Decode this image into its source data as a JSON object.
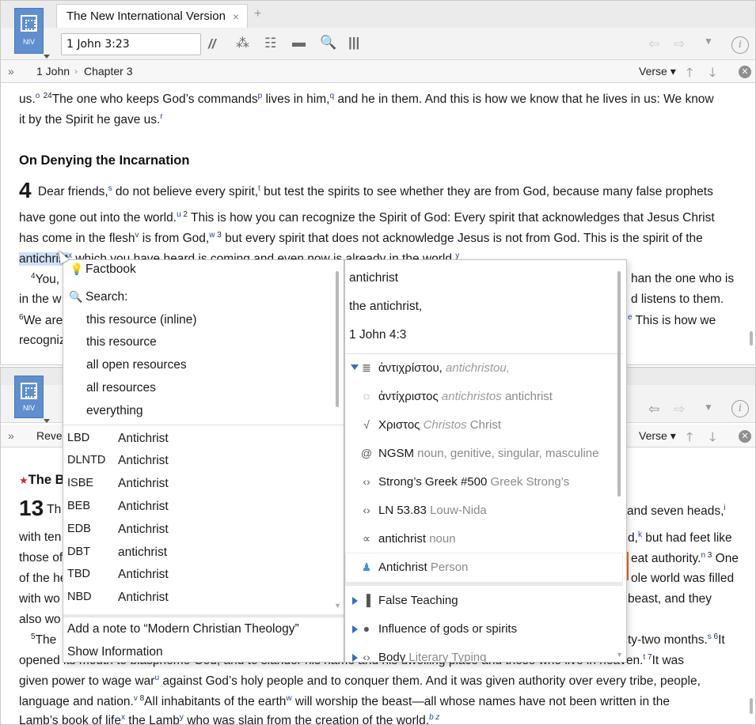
{
  "pane_top": {
    "logo_label": "NIV",
    "tab_title": "The New International Version",
    "tab_close": "×",
    "new_tab": "+",
    "reference_input": "1 John 3:23",
    "breadcrumb": [
      "1 John",
      "Chapter 3"
    ],
    "crumb_sep": "›",
    "expand": "»",
    "verse_selector": "Verse ▾",
    "up": "🡑",
    "down": "🡓",
    "close": "✕",
    "info": "i",
    "line1": {
      "a": "us.",
      "fn_o": "o",
      "v24": "24",
      "b": "The one who keeps God’s commands",
      "fn_p": "p",
      "c": " lives in him,",
      "fn_q": "q",
      "d": " and he in them. And this is how we know that he lives in us: We know"
    },
    "line2": {
      "a": "it by the Spirit he gave us.",
      "fn_r": "r"
    },
    "heading": "On Denying the Incarnation",
    "chapter": "4",
    "line3": {
      "a": "Dear friends,",
      "fn_s": "s",
      "b": " do not believe every spirit,",
      "fn_t": "t",
      "c": " but test the spirits to see whether they are from God, because many false prophets"
    },
    "line4": {
      "a": "have gone out into the world.",
      "fn_u": "u",
      "v2": " 2",
      "b": "This is how you can recognize the Spirit of God: Every spirit that acknowledges that Jesus Christ"
    },
    "line5": {
      "a": "has come in the flesh",
      "fn_v": "v",
      "b": " is from God,",
      "fn_w": "w",
      "v3": " 3",
      "c": "but every spirit that does not acknowledge Jesus is not from God. This is the spirit of the"
    },
    "line6": {
      "highlight": "antichrist",
      "fn_x": "x",
      "b": " which you have heard is coming and even now is already in the world.",
      "fn_y": "y"
    },
    "line7": {
      "v4": "4",
      "a": "You,",
      "b": "han the one who is"
    },
    "line8": {
      "a": "in the w",
      "b": "d listens to them."
    },
    "line9": {
      "v6": "6",
      "a": "We are",
      "fn_e": "e",
      "b": " This is how we"
    },
    "line10": {
      "a": "recogniz"
    }
  },
  "pane_bottom": {
    "logo_label": "NIV",
    "breadcrumb_first": "Revel",
    "expand": "»",
    "verse_selector": "Verse ▾",
    "up": "🡑",
    "down": "🡓",
    "close": "✕",
    "info": "i",
    "heading_star": "★",
    "heading": "The B",
    "chapter": "13",
    "lines": {
      "l1a": "Th",
      "l1b": "and seven heads,",
      "l1fn": "i",
      "l2a": "with ten",
      "l2b": "d,",
      "l2fn": "k",
      "l2c": " but had feet like",
      "l3a": "those of",
      "l3b": "eat authority.",
      "l3fn": "n",
      "l3v": " 3",
      "l3c": " One",
      "l4a": "of the he",
      "l4b": "ole world was filled",
      "l5a": "with wo",
      "l5b": " beast, and they",
      "l6a": "also wo",
      "l7v": "5",
      "l7a": "The",
      "l7b": "ty-two months.",
      "l7fn": "s",
      "l7v6": " 6",
      "l7c": "It",
      "l8a": "opened its mouth to blaspheme God, and to slander his name and his dwelling place and those who live in heaven.",
      "l8fn": "t",
      "l8v": " 7",
      "l8b": "It was",
      "l9a": "given power to wage war",
      "l9fn": "u",
      "l9b": " against God’s holy people and to conquer them. And it was given authority over every tribe, people,",
      "l10a": "language and nation.",
      "l10fn": "v",
      "l10v": " 8",
      "l10b": "All inhabitants of the earth",
      "l10fn2": "w",
      "l10c": " will worship the beast—all whose names have not been written in the",
      "l11a": "Lamb’s book of life",
      "l11fn": "x",
      "l11b": " the Lamb",
      "l11fn2": "y",
      "l11c": " who was slain from the creation of the world.",
      "l11fn3": "b z"
    }
  },
  "popup_left": {
    "factbook": "Factbook",
    "search_label": "Search:",
    "search_options": [
      "this resource (inline)",
      "this resource",
      "all open resources",
      "all resources",
      "everything"
    ],
    "dictionary_rows": [
      {
        "abbr": "LBD",
        "term": "Antichrist"
      },
      {
        "abbr": "DLNTD",
        "term": "Antichrist"
      },
      {
        "abbr": "ISBE",
        "term": "Antichrist"
      },
      {
        "abbr": "BEB",
        "term": "Antichrist"
      },
      {
        "abbr": "EDB",
        "term": "Antichrist"
      },
      {
        "abbr": "DBT",
        "term": "antichrist"
      },
      {
        "abbr": "TBD",
        "term": "Antichrist"
      },
      {
        "abbr": "NBD",
        "term": "Antichrist"
      }
    ],
    "add_note": "Add a note to “Modern Christian Theology”",
    "show_info": "Show Information"
  },
  "popup_right": {
    "word": "antichrist",
    "phrase": "the antichrist,",
    "reference": "1 John 4:3",
    "rows": [
      {
        "icon": "≣",
        "icon_name": "text-icon",
        "main": "ἀντιχρίστου,",
        "translit": "antichristou,",
        "gloss": ""
      },
      {
        "icon": "◌",
        "icon_name": "lemma-icon",
        "main": "ἀντίχριστος",
        "translit": "antichristos",
        "gloss": "antichrist"
      },
      {
        "icon": "√",
        "icon_name": "root-icon",
        "main": "Χριστος",
        "translit": "Christos",
        "gloss": "Christ"
      },
      {
        "icon": "@",
        "icon_name": "morphology-icon",
        "main": "NGSM",
        "translit": "",
        "gloss": "noun, genitive, singular, masculine"
      },
      {
        "icon": "‹›",
        "icon_name": "strongs-icon",
        "main": "Strong’s Greek #500",
        "translit": "",
        "gloss": "Greek Strong’s"
      },
      {
        "icon": "‹›",
        "icon_name": "louw-nida-icon",
        "main": "LN 53.83",
        "translit": "",
        "gloss": "Louw-Nida"
      },
      {
        "icon": "∝",
        "icon_name": "sense-icon",
        "main": "antichrist",
        "translit": "",
        "gloss": "noun"
      },
      {
        "icon": "♟",
        "icon_name": "person-icon",
        "main": "Antichrist",
        "translit": "",
        "gloss": "Person"
      }
    ],
    "topics": [
      {
        "icon": "▐",
        "icon_name": "topic-icon",
        "main": "False Teaching",
        "gloss": ""
      },
      {
        "icon": "●",
        "icon_name": "speech-bubble-icon",
        "main": "Influence of gods or spirits",
        "gloss": ""
      },
      {
        "icon": "‹›",
        "icon_name": "literary-typing-icon",
        "main": "Body",
        "gloss": "Literary Typing"
      }
    ]
  }
}
